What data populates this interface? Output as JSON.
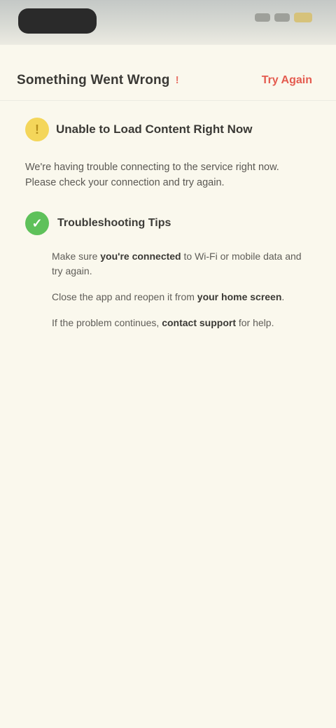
{
  "status_bar": {
    "colors": {
      "pill": "#2a2a2a",
      "battery": "#d6c27a"
    }
  },
  "header": {
    "title": "Something Went Wrong",
    "badge": "!",
    "action_label": "Try Again"
  },
  "warning": {
    "icon": "warning-icon",
    "title": "Unable to Load Content Right Now",
    "intro": "We're having trouble connecting to the service right now. Please check your connection and try again."
  },
  "status": {
    "icon": "check-icon",
    "title": "Troubleshooting Tips"
  },
  "tips": [
    {
      "pre": "Make sure ",
      "strong": "you're connected",
      "post": " to Wi-Fi or mobile data and try again."
    },
    {
      "pre": "Close the app and reopen it from ",
      "strong": "your home screen",
      "post": "."
    },
    {
      "pre": "If the problem continues, ",
      "strong": "contact support",
      "post": " for help."
    }
  ],
  "colors": {
    "background": "#faf8ed",
    "accent": "#e45b4f",
    "warning": "#f4d65a",
    "success": "#5ec15a"
  }
}
